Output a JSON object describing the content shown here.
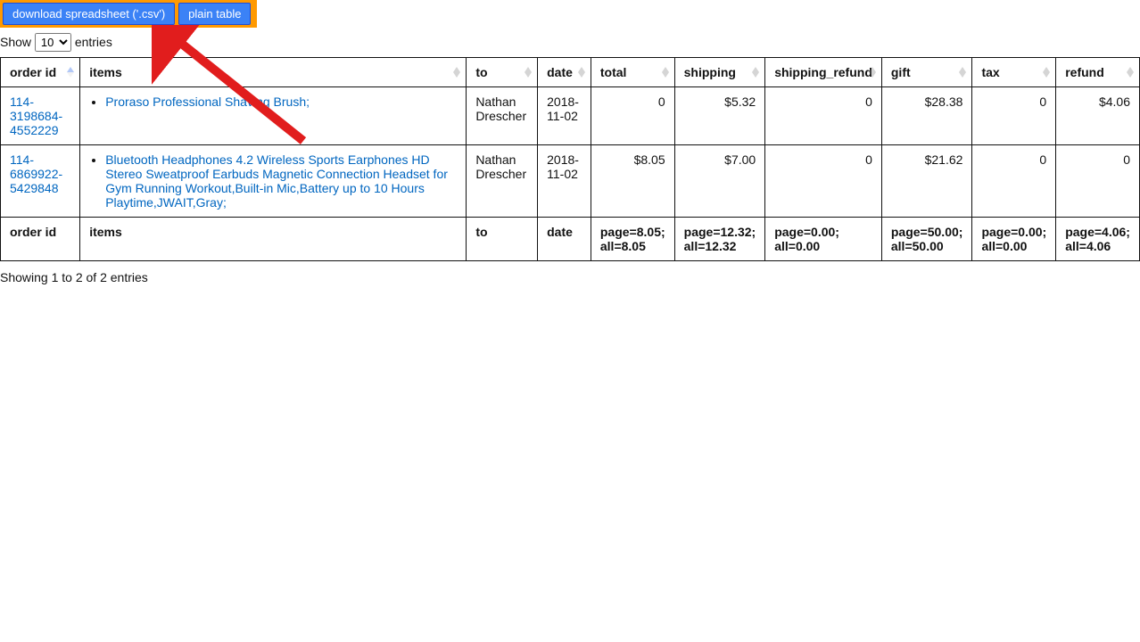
{
  "toolbar": {
    "download_csv_label": "download spreadsheet ('.csv')",
    "plain_table_label": "plain table"
  },
  "controls": {
    "show_prefix": "Show",
    "show_suffix": "entries",
    "entries_value": "10"
  },
  "columns": [
    "order id",
    "items",
    "to",
    "date",
    "total",
    "shipping",
    "shipping_refund",
    "gift",
    "tax",
    "refund"
  ],
  "rows": [
    {
      "order_id": "114-3198684-4552229",
      "items": [
        "Proraso Professional Shaving Brush;"
      ],
      "to": "Nathan Drescher",
      "date": "2018-11-02",
      "total": "0",
      "shipping": "$5.32",
      "shipping_refund": "0",
      "gift": "$28.38",
      "tax": "0",
      "refund": "$4.06"
    },
    {
      "order_id": "114-6869922-5429848",
      "items": [
        "Bluetooth Headphones 4.2 Wireless Sports Earphones HD Stereo Sweatproof Earbuds Magnetic Connection Headset for Gym Running Workout,Built-in Mic,Battery up to 10 Hours Playtime,JWAIT,Gray;"
      ],
      "to": "Nathan Drescher",
      "date": "2018-11-02",
      "total": "$8.05",
      "shipping": "$7.00",
      "shipping_refund": "0",
      "gift": "$21.62",
      "tax": "0",
      "refund": "0"
    }
  ],
  "footer": {
    "order_id": "order id",
    "items": "items",
    "to": "to",
    "date": "date",
    "total": "page=8.05; all=8.05",
    "shipping": "page=12.32; all=12.32",
    "shipping_refund": "page=0.00; all=0.00",
    "gift": "page=50.00; all=50.00",
    "tax": "page=0.00; all=0.00",
    "refund": "page=4.06; all=4.06"
  },
  "info_text": "Showing 1 to 2 of 2 entries"
}
